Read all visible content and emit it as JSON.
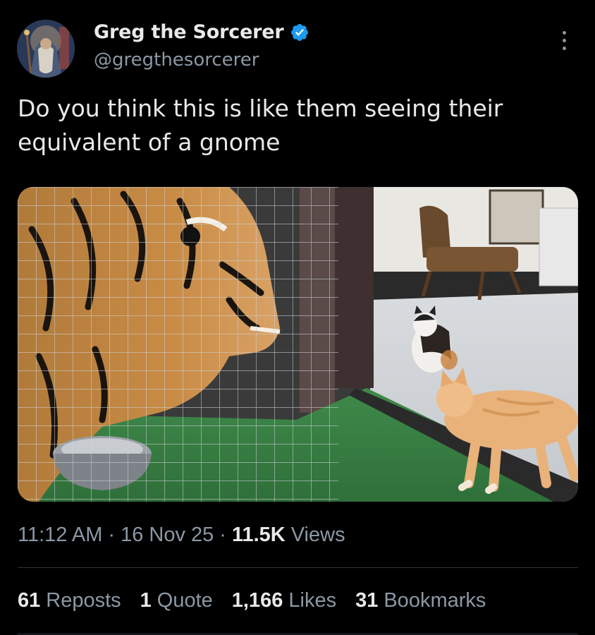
{
  "author": {
    "display_name": "Greg the Sorcerer",
    "handle": "@gregthesorcerer",
    "verified_icon": "verified-badge-icon",
    "verified_color": "#1d9bf0"
  },
  "tweet": {
    "text": "Do you think this is like them seeing their\nequivalent of a gnome",
    "media_icon": "photo-tiger-and-cats"
  },
  "meta": {
    "time": "11:12 AM",
    "separator": "·",
    "date": "16 Nov 25",
    "views_count": "11.5K",
    "views_label": "Views"
  },
  "stats": [
    {
      "count": "61",
      "label": "Reposts"
    },
    {
      "count": "1",
      "label": "Quote"
    },
    {
      "count": "1,166",
      "label": "Likes"
    },
    {
      "count": "31",
      "label": "Bookmarks"
    }
  ],
  "colors": {
    "background": "#000000",
    "primary_text": "#e7e9ea",
    "secondary_text": "#8b98a5",
    "divider": "#2f3336"
  }
}
